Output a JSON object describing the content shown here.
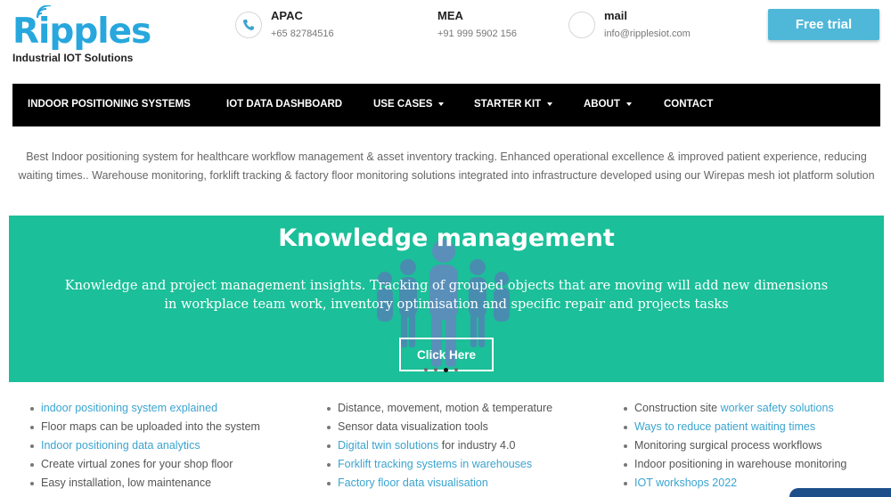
{
  "brand": {
    "logo_text": "Ripples",
    "tagline": "Industrial IOT Solutions"
  },
  "contacts": [
    {
      "title": "APAC",
      "value": "+65 82784516",
      "icon": "phone-icon"
    },
    {
      "title": "MEA",
      "value": "+91 999 5902 156",
      "icon": "none"
    },
    {
      "title": "mail",
      "value": "info@ripplesiot.com",
      "icon": "mail-circle-icon"
    }
  ],
  "free_trial_label": "Free trial",
  "nav": {
    "items": [
      {
        "label": "INDOOR POSITIONING SYSTEMS",
        "dropdown": false
      },
      {
        "label": "IOT DATA DASHBOARD",
        "dropdown": false
      },
      {
        "label": "USE CASES",
        "dropdown": true
      },
      {
        "label": "STARTER KIT",
        "dropdown": true
      },
      {
        "label": "ABOUT",
        "dropdown": true
      },
      {
        "label": "CONTACT",
        "dropdown": false
      }
    ]
  },
  "intro": "Best Indoor positioning system for healthcare workflow management & asset inventory tracking.  Enhanced operational excellence & improved patient experience, reducing waiting times.. Warehouse monitoring, forklift  tracking & factory floor monitoring solutions integrated into infrastructure developed using our Wirepas mesh iot platform solution",
  "hero": {
    "title": "Knowledge management",
    "text": "Knowledge and project management insights. Tracking of grouped objects that are moving will add new dimensions in workplace team work, inventory optimisation and specific repair and projects tasks",
    "button": "Click Here",
    "slide_count": 4,
    "active_slide": 3,
    "background_color": "#1bbf99"
  },
  "lists": {
    "col1": [
      {
        "link": "indoor positioning system explained",
        "text": ""
      },
      {
        "link": "",
        "text": "Floor maps can be uploaded into the system"
      },
      {
        "link": "Indoor positioning data analytics",
        "text": ""
      },
      {
        "link": "",
        "text": "Create virtual zones for your shop floor"
      },
      {
        "link": "",
        "text": "Easy installation, low maintenance"
      }
    ],
    "col2": [
      {
        "link": "",
        "text": "Distance, movement, motion & temperature"
      },
      {
        "link": "",
        "text": "Sensor data visualization tools"
      },
      {
        "link": "Digital twin solutions",
        "text": " for industry 4.0"
      },
      {
        "link": "Forklift tracking systems in warehouses",
        "text": ""
      },
      {
        "link": "Factory floor data visualisation",
        "text": ""
      }
    ],
    "col3": [
      {
        "prefix": "Construction site ",
        "link": "worker safety solutions",
        "text": ""
      },
      {
        "prefix": "",
        "link": "Ways to reduce patient waiting times",
        "text": ""
      },
      {
        "prefix": "",
        "link": "",
        "text": "Monitoring surgical process workflows"
      },
      {
        "prefix": "",
        "link": "",
        "text": "Indoor positioning in warehouse monitoring"
      },
      {
        "prefix": "",
        "link": "IOT workshops 2022",
        "text": ""
      }
    ]
  },
  "colors": {
    "brand_blue": "#27a7dd",
    "link": "#3ba4cf",
    "button": "#4fb7d8",
    "nav_bg": "#000000"
  }
}
